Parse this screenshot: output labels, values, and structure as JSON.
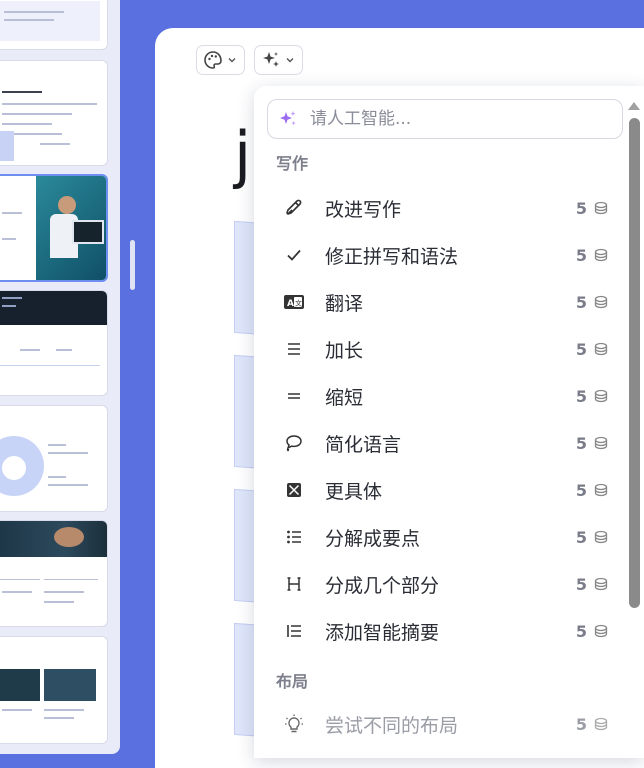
{
  "search": {
    "placeholder": "请人工智能..."
  },
  "sections": {
    "writing": "写作",
    "layout": "布局"
  },
  "menu": [
    {
      "label": "改进写作",
      "cost": "5",
      "icon": "pen-nib-icon"
    },
    {
      "label": "修正拼写和语法",
      "cost": "5",
      "icon": "check-icon"
    },
    {
      "label": "翻译",
      "cost": "5",
      "icon": "translate-icon"
    },
    {
      "label": "加长",
      "cost": "5",
      "icon": "lines-three-icon"
    },
    {
      "label": "缩短",
      "cost": "5",
      "icon": "lines-two-icon"
    },
    {
      "label": "简化语言",
      "cost": "5",
      "icon": "speech-bubble-icon"
    },
    {
      "label": "更具体",
      "cost": "5",
      "icon": "focus-square-icon"
    },
    {
      "label": "分解成要点",
      "cost": "5",
      "icon": "bullet-list-icon"
    },
    {
      "label": "分成几个部分",
      "cost": "5",
      "icon": "heading-h-icon"
    },
    {
      "label": "添加智能摘要",
      "cost": "5",
      "icon": "summary-list-icon"
    }
  ],
  "layout_menu": [
    {
      "label": "尝试不同的布局",
      "cost": "5",
      "icon": "lightbulb-icon"
    }
  ],
  "editor": {
    "title_fragment": "j"
  },
  "colors": {
    "background": "#5a6fe0",
    "accent_sparkle": "#9b6bf0",
    "thumb_selected_border": "#6d8ff0"
  }
}
